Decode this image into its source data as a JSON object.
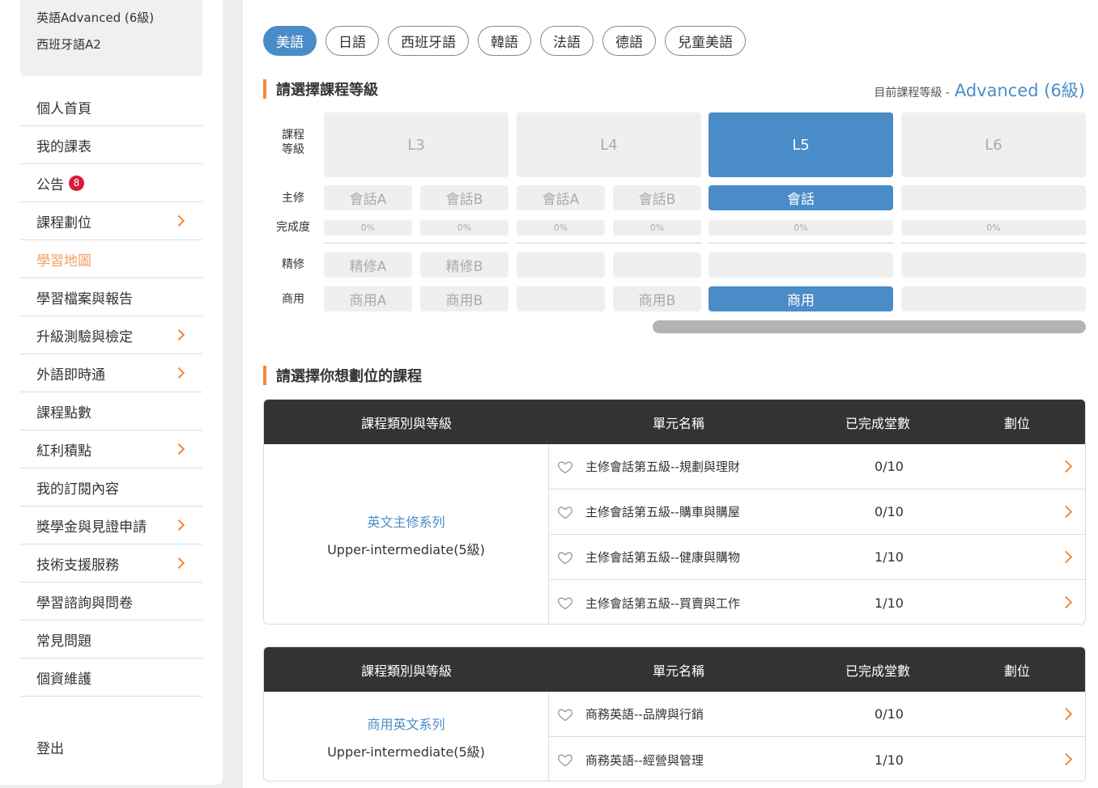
{
  "sidebar": {
    "levels": [
      "英語Advanced (6級)",
      "西班牙語A2"
    ],
    "items": [
      {
        "label": "個人首頁",
        "chevron": false,
        "active": false
      },
      {
        "label": "我的課表",
        "chevron": false,
        "active": false
      },
      {
        "label": "公告",
        "badge": "8",
        "chevron": false,
        "active": false
      },
      {
        "label": "課程劃位",
        "chevron": true,
        "active": false
      },
      {
        "label": "學習地圖",
        "chevron": false,
        "active": true
      },
      {
        "label": "學習檔案與報告",
        "chevron": false,
        "active": false
      },
      {
        "label": "升級測驗與檢定",
        "chevron": true,
        "active": false
      },
      {
        "label": "外語即時通",
        "chevron": true,
        "active": false
      },
      {
        "label": "課程點數",
        "chevron": false,
        "active": false
      },
      {
        "label": "紅利積點",
        "chevron": true,
        "active": false
      },
      {
        "label": "我的訂閱內容",
        "chevron": false,
        "active": false
      },
      {
        "label": "獎學金與見證申請",
        "chevron": true,
        "active": false
      },
      {
        "label": "技術支援服務",
        "chevron": true,
        "active": false
      },
      {
        "label": "學習諮詢與問卷",
        "chevron": false,
        "active": false
      },
      {
        "label": "常見問題",
        "chevron": false,
        "active": false
      },
      {
        "label": "個資維護",
        "chevron": false,
        "active": false
      }
    ],
    "logout": "登出"
  },
  "lang_tabs": [
    "美語",
    "日語",
    "西班牙語",
    "韓語",
    "法語",
    "德語",
    "兒童美語"
  ],
  "active_lang": 0,
  "level_section": {
    "title": "請選擇課程等級",
    "current_label": "目前課程等級 -",
    "current_value": "Advanced (6級)"
  },
  "grid": {
    "labels": {
      "level": "課程\n等級",
      "major": "主修",
      "progress": "完成度",
      "intensive": "精修",
      "business": "商用"
    },
    "levels": [
      {
        "name": "L3",
        "selected": false,
        "major": [
          "會話A",
          "會話B"
        ],
        "progress": [
          "0%",
          "0%"
        ],
        "intensive": [
          "精修A",
          "精修B"
        ],
        "business": [
          "商用A",
          "商用B"
        ]
      },
      {
        "name": "L4",
        "selected": false,
        "major": [
          "會話A",
          "會話B"
        ],
        "progress": [
          "0%",
          "0%"
        ],
        "intensive": [
          "",
          ""
        ],
        "business": [
          "",
          "商用B"
        ]
      },
      {
        "name": "L5",
        "selected": true,
        "major": [
          "會話"
        ],
        "progress": [
          "0%"
        ],
        "intensive": [
          ""
        ],
        "business": [
          "商用"
        ]
      },
      {
        "name": "L6",
        "selected": false,
        "major": [
          ""
        ],
        "progress": [
          "0%"
        ],
        "intensive": [
          ""
        ],
        "business": [
          ""
        ]
      }
    ]
  },
  "course_section": {
    "title": "請選擇你想劃位的課程"
  },
  "table_headers": [
    "課程類別與等級",
    "單元名稱",
    "已完成堂數",
    "劃位"
  ],
  "tables": [
    {
      "series": "英文主修系列",
      "level": "Upper-intermediate(5級)",
      "units": [
        {
          "name": "主修會話第五級--規劃與理財",
          "count": "0/10"
        },
        {
          "name": "主修會話第五級--購車與購屋",
          "count": "0/10"
        },
        {
          "name": "主修會話第五級--健康與購物",
          "count": "1/10"
        },
        {
          "name": "主修會話第五級--買賣與工作",
          "count": "1/10"
        }
      ]
    },
    {
      "series": "商用英文系列",
      "level": "Upper-intermediate(5級)",
      "units": [
        {
          "name": "商務英語--品牌與行銷",
          "count": "0/10"
        },
        {
          "name": "商務英語--經營與管理",
          "count": "1/10"
        }
      ]
    }
  ],
  "colors": {
    "accent": "#f08a3c",
    "primary": "#4a8cc7",
    "header": "#333333"
  }
}
